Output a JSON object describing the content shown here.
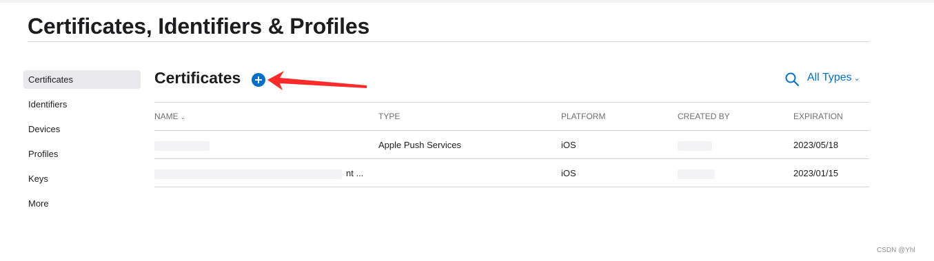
{
  "page": {
    "title": "Certificates, Identifiers & Profiles"
  },
  "sidebar": {
    "items": [
      {
        "label": "Certificates",
        "active": true
      },
      {
        "label": "Identifiers"
      },
      {
        "label": "Devices"
      },
      {
        "label": "Profiles"
      },
      {
        "label": "Keys"
      },
      {
        "label": "More"
      }
    ]
  },
  "section": {
    "title": "Certificates",
    "add_icon": "plus-circle-icon"
  },
  "toolbar": {
    "search_icon": "magnifier-icon",
    "filter_label": "All Types",
    "filter_chevron": "⌄"
  },
  "table": {
    "headers": [
      "NAME",
      "TYPE",
      "PLATFORM",
      "CREATED BY",
      "EXPIRATION"
    ],
    "sort_indicator": "⌄",
    "rows": [
      {
        "name": "",
        "type": "Apple Push Services",
        "platform": "iOS",
        "created_by": "",
        "expiration": "2023/05/18"
      },
      {
        "name": "nt ...",
        "type": "",
        "platform": "iOS",
        "created_by": "",
        "expiration": "2023/01/15"
      }
    ]
  },
  "watermark": "CSDN @Yhl",
  "colors": {
    "accent": "#0070c9",
    "annotation_arrow": "#ff2a2a",
    "sidebar_active_bg": "#e8e8ed",
    "divider": "#d2d2d7"
  }
}
